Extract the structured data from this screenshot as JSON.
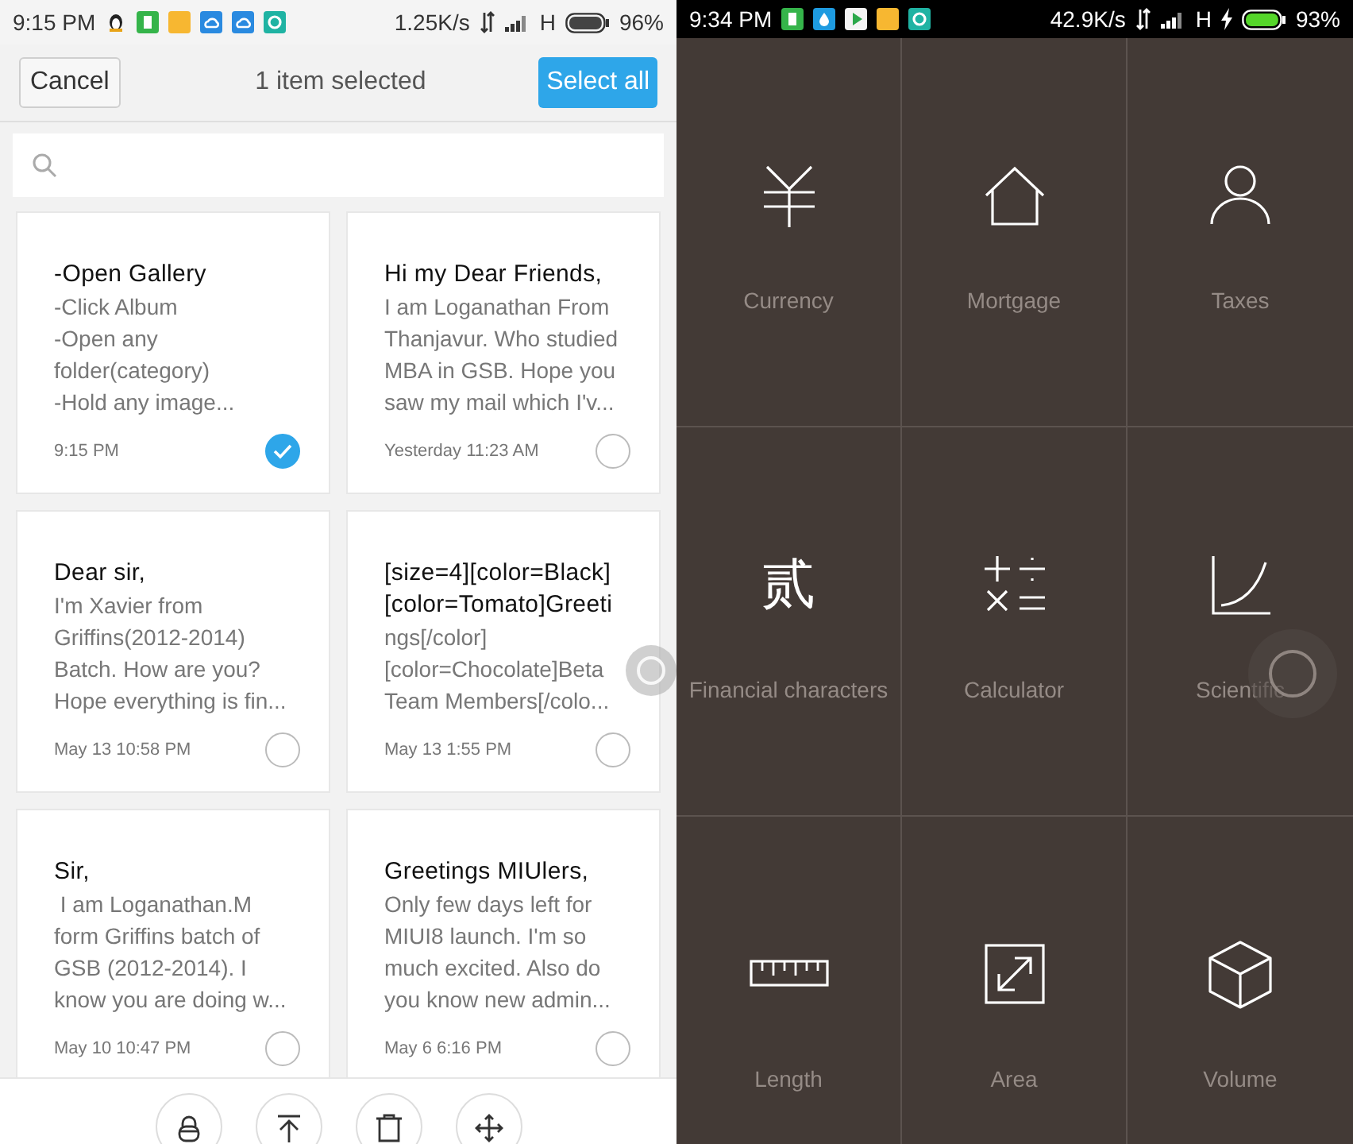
{
  "notes_screen": {
    "status_bar": {
      "time": "9:15 PM",
      "speed": "1.25K/s",
      "network": "H",
      "battery": "96%"
    },
    "header": {
      "cancel": "Cancel",
      "title": "1 item selected",
      "select_all": "Select all"
    },
    "notes": [
      {
        "title": "-Open Gallery",
        "body": "-Click Album\n-Open any\nfolder(category)\n-Hold any image...",
        "date": "9:15 PM",
        "selected": true
      },
      {
        "title": "Hi my Dear Friends,",
        "body": "I am Loganathan From\nThanjavur. Who studied\nMBA in GSB. Hope you\nsaw my mail which I'v...",
        "date": "Yesterday 11:23 AM",
        "selected": false
      },
      {
        "title": "Dear sir,",
        "body": "I'm Xavier from\nGriffins(2012-2014)\nBatch. How are you?\nHope everything is fin...",
        "date": "May 13 10:58 PM",
        "selected": false
      },
      {
        "title": "[size=4][color=Black]\n[color=Tomato]Greeti",
        "body": "ngs[/color]\n[color=Chocolate]Beta\nTeam Members[/colo...",
        "date": "May 13 1:55 PM",
        "selected": false
      },
      {
        "title": "Sir,",
        "body": " I am Loganathan.M\nform Griffins batch of\nGSB (2012-2014). I\nknow you are doing w...",
        "date": "May 10 10:47 PM",
        "selected": false
      },
      {
        "title": "Greetings MIUlers,",
        "body": "Only few days left for\nMIUI8 launch. I'm so\nmuch excited. Also do\nyou know new admin...",
        "date": "May 6 6:16 PM",
        "selected": false
      }
    ]
  },
  "tools_screen": {
    "status_bar": {
      "time": "9:34 PM",
      "speed": "42.9K/s",
      "network": "H",
      "battery": "93%"
    },
    "tools": [
      {
        "label": "Currency"
      },
      {
        "label": "Mortgage"
      },
      {
        "label": "Taxes"
      },
      {
        "label": "Financial characters",
        "symbol": "贰"
      },
      {
        "label": "Calculator"
      },
      {
        "label": "Scientific"
      },
      {
        "label": "Length"
      },
      {
        "label": "Area"
      },
      {
        "label": "Volume"
      }
    ]
  }
}
